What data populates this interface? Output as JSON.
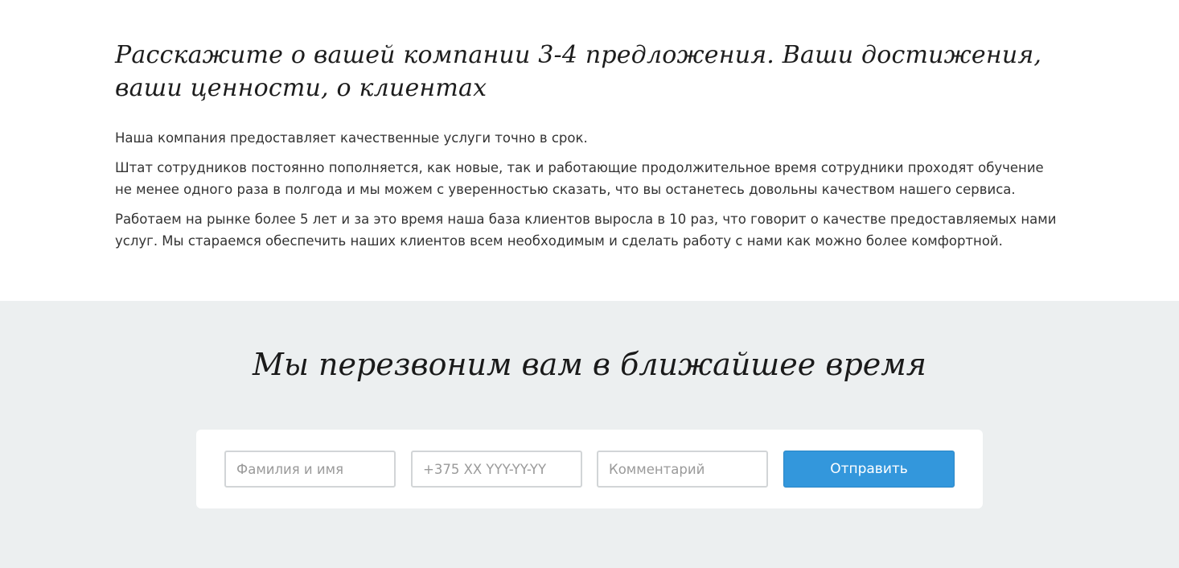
{
  "about": {
    "title": "Расскажите о вашей компании 3-4 предложения. Ваши достижения, ваши ценности, о клиентах",
    "paragraphs": [
      "Наша компания предоставляет качественные услуги точно в срок.",
      "Штат сотрудников постоянно пополняется, как новые, так и работающие продолжительное время сотрудники проходят обучение не менее одного раза в полгода и мы можем с уверенностью сказать, что вы останетесь довольны качеством нашего сервиса.",
      "Работаем на рынке более 5 лет и за это время наша база клиентов выросла в 10 раз, что говорит о качестве предоставляемых нами услуг. Мы стараемся обеспечить наших клиентов всем необходимым и сделать работу с нами как можно более комфортной."
    ]
  },
  "callback": {
    "title": "Мы перезвоним вам в ближайшее время",
    "form": {
      "name_placeholder": "Фамилия и имя",
      "phone_placeholder": "+375 XX YYY-YY-YY",
      "comment_placeholder": "Комментарий",
      "submit_label": "Отправить"
    }
  },
  "colors": {
    "section_background": "#eceff0",
    "button_accent": "#3397dc"
  }
}
